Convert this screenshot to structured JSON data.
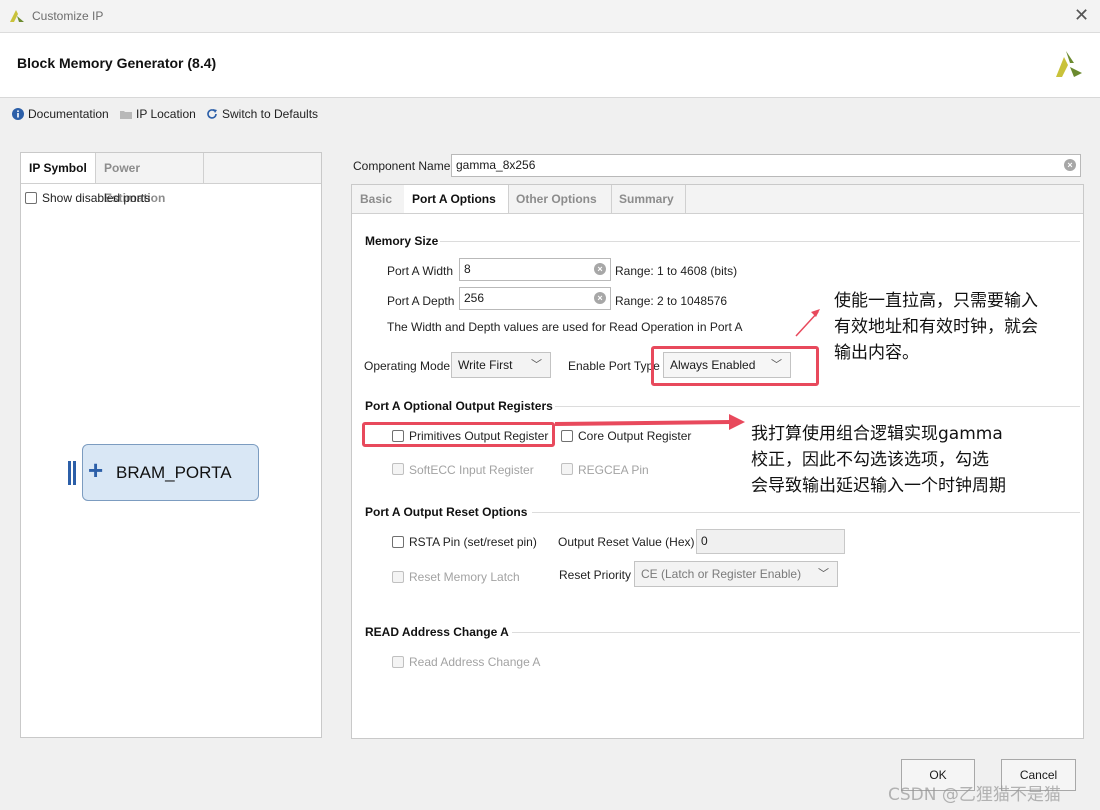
{
  "window": {
    "title": "Customize IP",
    "close": "✕"
  },
  "header": {
    "title": "Block Memory Generator (8.4)"
  },
  "toolbar": {
    "documentation": "Documentation",
    "ip_location": "IP Location",
    "switch_defaults": "Switch to Defaults"
  },
  "left_panel": {
    "tabs": [
      "IP Symbol",
      "Power Estimation"
    ],
    "show_disabled_ports": "Show disabled ports",
    "symbol_plus": "+",
    "symbol_label": "BRAM_PORTA"
  },
  "component": {
    "label": "Component Name",
    "value": "gamma_8x256"
  },
  "tabs": [
    "Basic",
    "Port A Options",
    "Other Options",
    "Summary"
  ],
  "memory_size": {
    "title": "Memory Size",
    "width_label": "Port A Width",
    "width_value": "8",
    "width_range": "Range: 1 to 4608 (bits)",
    "depth_label": "Port A Depth",
    "depth_value": "256",
    "depth_range": "Range: 2 to 1048576",
    "note": "The Width and Depth values are used for Read Operation in Port A"
  },
  "operating_mode": {
    "label": "Operating Mode",
    "value": "Write First"
  },
  "enable_port_type": {
    "label": "Enable Port Type",
    "value": "Always Enabled"
  },
  "optional_registers": {
    "title": "Port A Optional Output Registers",
    "primitives": "Primitives Output Register",
    "core": "Core Output Register",
    "softecc": "SoftECC Input Register",
    "regcea": "REGCEA Pin"
  },
  "reset_options": {
    "title": "Port A Output Reset Options",
    "rsta": "RSTA Pin (set/reset pin)",
    "reset_value_label": "Output Reset Value (Hex)",
    "reset_value": "0",
    "reset_memory_latch": "Reset Memory Latch",
    "reset_priority_label": "Reset Priority",
    "reset_priority_value": "CE (Latch or Register Enable)"
  },
  "read_address": {
    "title": "READ Address Change A",
    "option": "Read Address Change A"
  },
  "buttons": {
    "ok": "OK",
    "cancel": "Cancel"
  },
  "annotations": {
    "note1": [
      "使能一直拉高，只需要输入",
      "有效地址和有效时钟，就会",
      "输出内容。"
    ],
    "note2": [
      "我打算使用组合逻辑实现gamma",
      "校正，因此不勾选该选项，勾选",
      "会导致输出延迟输入一个时钟周期"
    ]
  },
  "watermark": "CSDN @乙狸猫不是猫",
  "colors": {
    "annotation_red": "#e8495c",
    "logo_yellow": "#c9c23a",
    "logo_green": "#6b8a2f"
  }
}
